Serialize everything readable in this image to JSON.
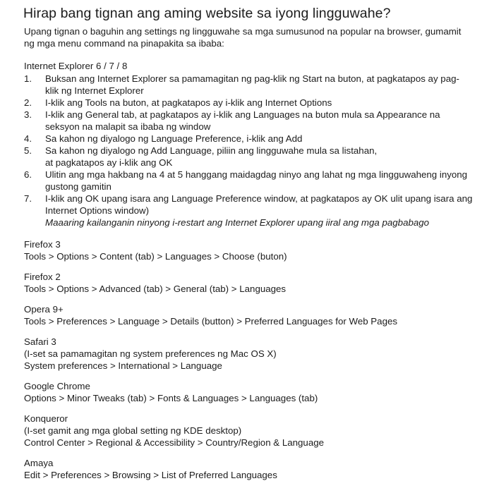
{
  "page": {
    "title": "Hirap bang tignan ang aming website sa iyong lingguwahe?",
    "intro": "Upang tignan o baguhin ang settings ng lingguwahe sa mga sumusunod na popular na browser, gumamit ng mga menu command na pinapakita sa ibaba:",
    "background_color": "#ffffff",
    "text_color": "#1c1c1c"
  },
  "ie_section": {
    "heading": "Internet Explorer 6 / 7 / 8",
    "steps": [
      {
        "number": "1.",
        "text": "Buksan ang Internet Explorer sa pamamagitan ng pag-klik ng Start na buton, at pagkatapos ay pag-klik ng Internet Explorer",
        "note": ""
      },
      {
        "number": "2.",
        "text": "I-klik ang Tools na buton, at pagkatapos ay i-klik ang Internet Options",
        "note": ""
      },
      {
        "number": "3.",
        "text": "I-klik ang General tab, at pagkatapos ay i-klik ang Languages na buton mula sa Appearance na seksyon na malapit sa ibaba ng window",
        "note": ""
      },
      {
        "number": "4.",
        "text": "Sa kahon ng diyalogo ng Language Preference, i-klik ang Add",
        "note": ""
      },
      {
        "number": "5.",
        "text": "Sa kahon ng diyalogo ng Add Language, piliin ang lingguwahe mula sa listahan,",
        "line2": "at pagkatapos ay i-klik ang OK",
        "note": ""
      },
      {
        "number": "6.",
        "text": "Ulitin ang mga hakbang na 4 at 5 hanggang maidagdag ninyo ang lahat ng mga lingguwaheng inyong gustong gamitin",
        "note": ""
      },
      {
        "number": "7.",
        "text": "I-klik ang OK upang isara ang Language Preference window, at pagkatapos ay OK ulit upang isara ang Internet Options window)",
        "note": "Maaaring kailanganin ninyong i-restart ang Internet Explorer upang iiral ang mga pagbabago"
      }
    ]
  },
  "browsers": [
    {
      "name": "Firefox 3",
      "note": "",
      "path": "Tools > Options > Content (tab) > Languages > Choose (buton)"
    },
    {
      "name": "Firefox 2",
      "note": "",
      "path": "Tools > Options > Advanced (tab) > General (tab) > Languages"
    },
    {
      "name": "Opera 9+",
      "note": "",
      "path": "Tools > Preferences > Language > Details (button) > Preferred Languages for Web Pages"
    },
    {
      "name": "Safari 3",
      "note": "(I-set sa pamamagitan ng system preferences ng Mac OS X)",
      "path": "System preferences > International > Language"
    },
    {
      "name": "Google Chrome",
      "note": "",
      "path": "Options > Minor Tweaks (tab) > Fonts & Languages > Languages (tab)"
    },
    {
      "name": "Konqueror",
      "note": "(I-set gamit ang mga global setting ng KDE desktop)",
      "path": "Control Center > Regional & Accessibility > Country/Region & Language"
    },
    {
      "name": "Amaya",
      "note": "",
      "path": "Edit > Preferences > Browsing > List of Preferred Languages"
    }
  ]
}
